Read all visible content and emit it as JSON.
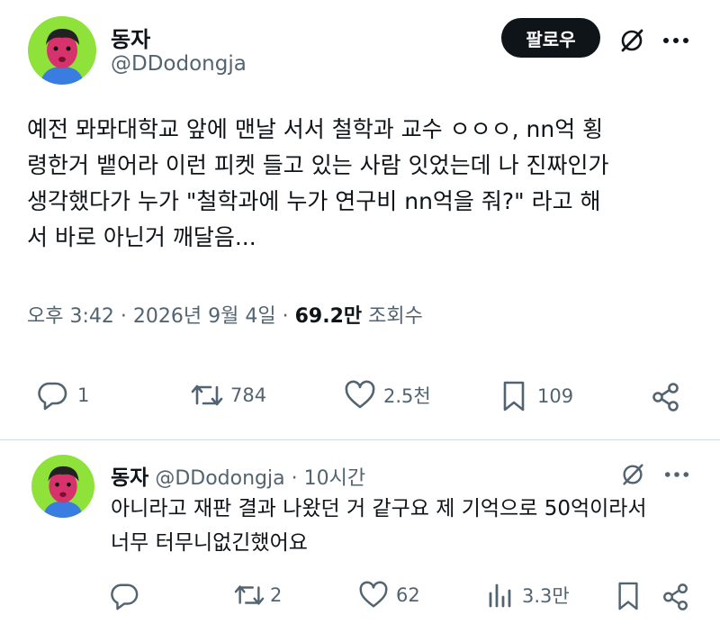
{
  "main_tweet": {
    "author_name": "동자",
    "handle": "@DDodongja",
    "follow_label": "팔로우",
    "text": "예전 뫄뫄대학교 앞에 맨날 서서 철학과 교수 ㅇㅇㅇ, nn억 횡\n령한거 뱉어라 이런 피켓 들고 있는 사람 잇었는데 나 진짜인가\n생각했다가 누가 \"철학과에 누가 연구비 nn억을 줘?\" 라고 해\n서 바로 아닌거 깨달음...",
    "time": "오후 3:42",
    "date": "2026년 9월 4일",
    "separator": "·",
    "views_count": "69.2만",
    "views_label": "조회수",
    "actions": {
      "replies": "1",
      "retweets": "784",
      "likes": "2.5천",
      "bookmarks": "109"
    }
  },
  "reply_tweet": {
    "author_name": "동자",
    "handle": "@DDodongja",
    "separator": "·",
    "time_ago": "10시간",
    "text": "아니라고 재판 결과 나왔던 거 같구요 제 기억으로 50억이라서\n너무 터무니없긴했어요",
    "actions": {
      "retweets": "2",
      "likes": "62",
      "views": "3.3만"
    }
  },
  "colors": {
    "avatar_bg": "#8fe23a",
    "text": "#0f1419",
    "muted": "#536471",
    "button_bg": "#0f1419"
  },
  "icons": [
    "grok-icon",
    "more-icon",
    "reply-icon",
    "retweet-icon",
    "like-icon",
    "bookmark-icon",
    "share-icon",
    "views-icon"
  ]
}
